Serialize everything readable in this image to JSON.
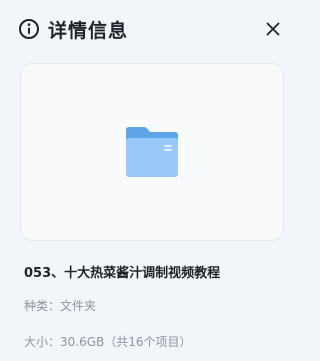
{
  "header": {
    "title": "详情信息",
    "icon": "info-icon",
    "close_icon": "close-icon"
  },
  "preview": {
    "icon": "folder-icon",
    "folder_color": "#8fc3f5"
  },
  "details": {
    "name": "053、十大热菜酱汁调制视频教程",
    "type_text": "种类：文件夹",
    "size_text": "大小：30.6GB（共16个项目）"
  }
}
